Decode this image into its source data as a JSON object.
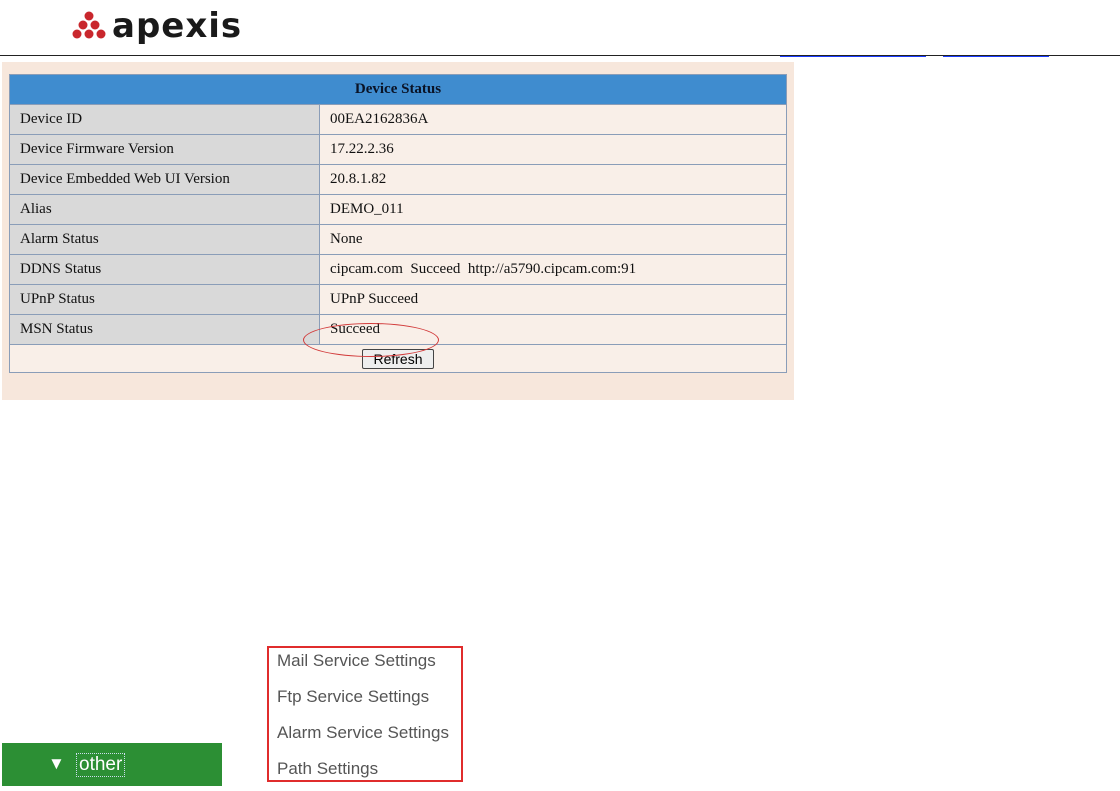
{
  "header": {
    "logo_text": "apexis"
  },
  "panel": {
    "title": "Device Status",
    "rows": [
      {
        "label": "Device ID",
        "value": "00EA2162836A"
      },
      {
        "label": "Device Firmware Version",
        "value": "17.22.2.36"
      },
      {
        "label": "Device Embedded Web UI Version",
        "value": "20.8.1.82"
      },
      {
        "label": "Alias",
        "value": "DEMO_011"
      },
      {
        "label": "Alarm Status",
        "value": "None"
      },
      {
        "label": "DDNS Status",
        "value": "cipcam.com  Succeed  http://a5790.cipcam.com:91"
      },
      {
        "label": "UPnP Status",
        "value": "UPnP Succeed"
      },
      {
        "label": "MSN Status",
        "value": "Succeed"
      }
    ],
    "refresh_label": "Refresh"
  },
  "menu": {
    "section_label": "other",
    "items": [
      "Mail Service Settings",
      "Ftp Service Settings",
      "Alarm Service Settings",
      "Path Settings"
    ]
  },
  "colors": {
    "table_header": "#3f8ccf",
    "panel_bg": "#f7e7dc",
    "label_cell": "#d9d9d9",
    "highlight": "#d23a3a",
    "menu_bar": "#2c8f34",
    "link": "#1a3cff"
  }
}
